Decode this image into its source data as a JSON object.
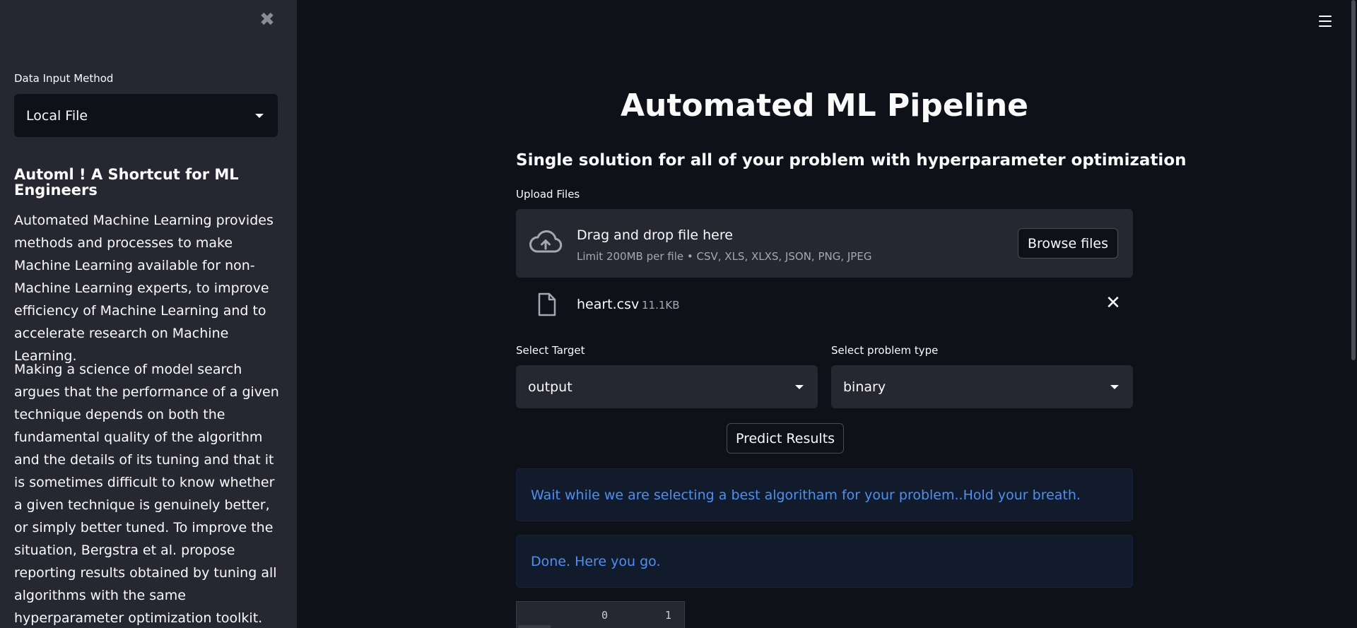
{
  "sidebar": {
    "input_method_label": "Data Input Method",
    "input_method_value": "Local File",
    "heading": "Automl ! A Shortcut for ML Engineers",
    "paragraph1": "Automated Machine Learning provides methods and processes to make Machine Learning available for non-Machine Learning experts, to improve efficiency of Machine Learning and to accelerate research on Machine Learning.",
    "paragraph2": "Making a science of model search argues that the performance of a given technique depends on both the fundamental quality of the algorithm and the details of its tuning and that it is sometimes difficult to know whether a given technique is genuinely better, or simply better tuned. To improve the situation, Bergstra et al. propose reporting results obtained by tuning all algorithms with the same hyperparameter optimization toolkit.",
    "close_glyph": "✖"
  },
  "main": {
    "title": "Automated ML Pipeline",
    "subtitle": "Single solution for all of your problem with hyperparameter optimization",
    "upload": {
      "label": "Upload Files",
      "drag_text": "Drag and drop file here",
      "limit_text": "Limit 200MB per file • CSV, XLS, XLXS, JSON, PNG, JPEG",
      "browse_label": "Browse files"
    },
    "file": {
      "name": "heart.csv",
      "size": "11.1KB",
      "remove_glyph": "✕"
    },
    "target": {
      "label": "Select Target",
      "value": "output"
    },
    "problem_type": {
      "label": "Select problem type",
      "value": "binary"
    },
    "predict_label": "Predict Results",
    "messages": [
      "Wait while we are selecting a best algoritham for your problem..Hold your breath.",
      "Done. Here you go."
    ],
    "table": {
      "columns": [
        "0",
        "1"
      ]
    }
  },
  "colors": {
    "background": "#0e1117",
    "sidebar": "#262730",
    "info_text": "#4f8ff0",
    "info_bg": "#111b2c"
  },
  "icons": {
    "close": "close-icon",
    "menu": "hamburger-icon",
    "upload": "cloud-upload-icon",
    "file": "file-icon",
    "dropdown": "chevron-down-icon"
  }
}
